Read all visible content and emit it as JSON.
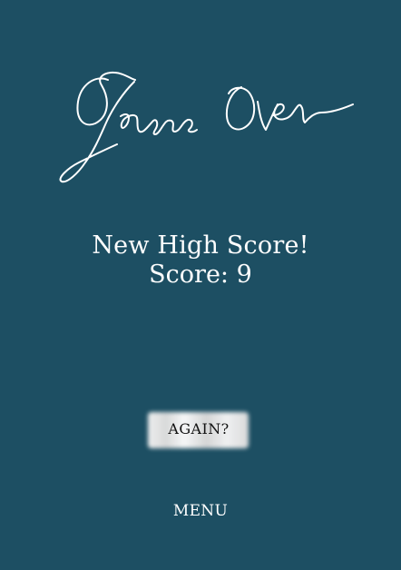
{
  "title_art": {
    "text": "Game Over"
  },
  "score_panel": {
    "headline": "New High Score!",
    "score_label": "Score:",
    "score_value": "9"
  },
  "buttons": {
    "again_label": "AGAIN?",
    "menu_label": "MENU"
  },
  "colors": {
    "background": "#1d4f63",
    "text": "#ffffff",
    "again_button_text": "#131313"
  }
}
